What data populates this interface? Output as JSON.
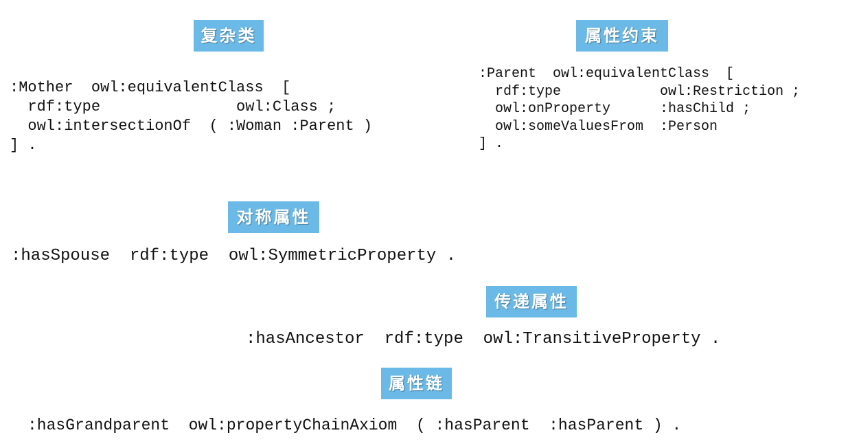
{
  "sections": {
    "complex_class": {
      "label": "复杂类",
      "lines": [
        ":Mother  owl:equivalentClass  [",
        "  rdf:type               owl:Class ;",
        "  owl:intersectionOf  ( :Woman :Parent )",
        "] ."
      ]
    },
    "property_restriction": {
      "label": "属性约束",
      "lines": [
        ":Parent  owl:equivalentClass  [",
        "  rdf:type            owl:Restriction ;",
        "  owl:onProperty      :hasChild ;",
        "  owl:someValuesFrom  :Person",
        "] ."
      ]
    },
    "symmetric_property": {
      "label": "对称属性",
      "line": ":hasSpouse  rdf:type  owl:SymmetricProperty ."
    },
    "transitive_property": {
      "label": "传递属性",
      "line": ":hasAncestor  rdf:type  owl:TransitiveProperty ."
    },
    "property_chain": {
      "label": "属性链",
      "line": ":hasGrandparent  owl:propertyChainAxiom  ( :hasParent  :hasParent ) ."
    }
  },
  "colors": {
    "label_background": "#6ab9e6",
    "label_text": "#ffffff",
    "code_text": "#111111",
    "background": "#ffffff"
  }
}
